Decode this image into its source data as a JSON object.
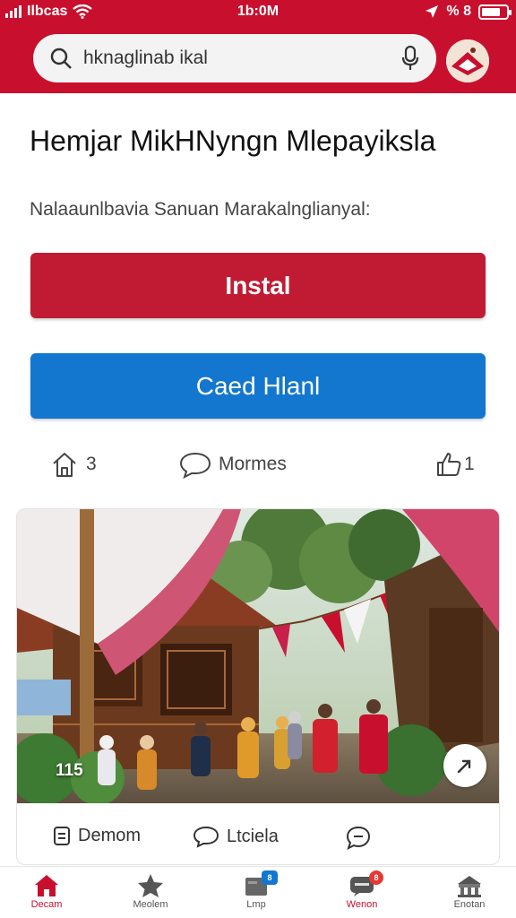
{
  "status_bar": {
    "carrier": "Ilbcas",
    "time": "1b:0M",
    "battery_percent": "% 8"
  },
  "search": {
    "query": "hknaglinab ikal"
  },
  "app": {
    "title": "Hemjar MikHNyngn Mlepayiksla",
    "subtitle": "Nalaaunlbavia Sanuan Marakalnglianyal:"
  },
  "buttons": {
    "install_label": "Instal",
    "secondary_label": "Caed Hlanl"
  },
  "stats": {
    "home_count": "3",
    "comments_label": "Mormes",
    "likes_count": "1"
  },
  "card": {
    "photo_count": "115",
    "actions": {
      "first_label": "Demom",
      "second_label": "Ltciela"
    }
  },
  "bottom_nav": {
    "items": [
      {
        "label": "Decam",
        "icon": "home-icon",
        "active": true
      },
      {
        "label": "Meolem",
        "icon": "star-icon",
        "active": false
      },
      {
        "label": "Lmp",
        "icon": "folder-icon",
        "badge": "8",
        "active": false
      },
      {
        "label": "Wenon",
        "icon": "chat-icon",
        "badge": "8",
        "active": false
      },
      {
        "label": "Enotan",
        "icon": "store-icon",
        "active": false
      }
    ]
  },
  "colors": {
    "brand": "#c8102e",
    "install": "#c11b33",
    "secondary": "#1377cf"
  }
}
